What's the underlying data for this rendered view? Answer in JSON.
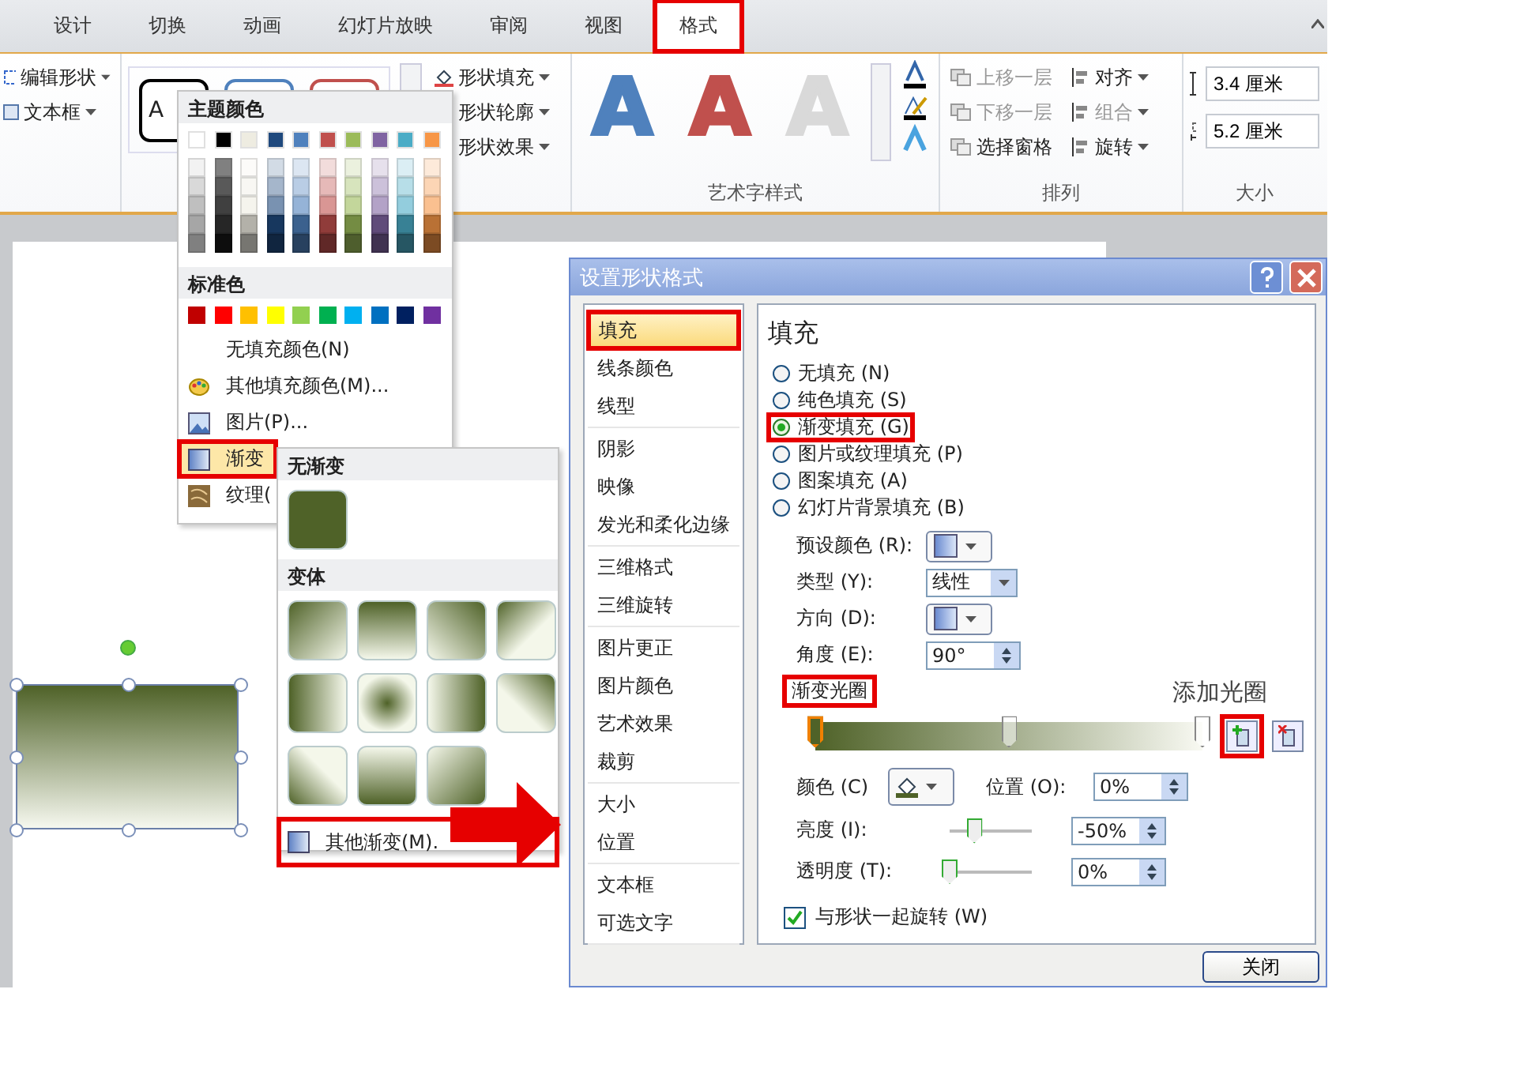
{
  "ribbon": {
    "tabs": [
      {
        "label": "设计",
        "selected": false,
        "highlighted": false
      },
      {
        "label": "切换",
        "selected": false,
        "highlighted": false
      },
      {
        "label": "动画",
        "selected": false,
        "highlighted": false
      },
      {
        "label": "幻灯片放映",
        "selected": false,
        "highlighted": false
      },
      {
        "label": "审阅",
        "selected": false,
        "highlighted": false
      },
      {
        "label": "视图",
        "selected": false,
        "highlighted": false
      },
      {
        "label": "格式",
        "selected": true,
        "highlighted": true
      }
    ],
    "insert_commands": [
      "编辑形状",
      "文本框"
    ],
    "shape_styles": [
      {
        "text": "A",
        "color": "#000000"
      },
      {
        "color": "#4f81bd"
      },
      {
        "color": "#c0504d"
      }
    ],
    "shape_commands": [
      "形状填充",
      "形状轮廓",
      "形状效果"
    ],
    "wordart_styles": [
      {
        "text": "A",
        "color": "#4f81bd"
      },
      {
        "text": "A",
        "color": "#c0504d"
      },
      {
        "text": "A",
        "color": "#d9d9d9"
      }
    ],
    "wordart_group": "艺术字样式",
    "arrange_commands": [
      {
        "label": "上移一层",
        "disabled": true
      },
      {
        "label": "下移一层",
        "disabled": true
      },
      {
        "label": "选择窗格",
        "disabled": false
      },
      {
        "label": "对齐",
        "disabled": false
      },
      {
        "label": "组合",
        "disabled": true
      },
      {
        "label": "旋转",
        "disabled": false
      }
    ],
    "arrange_group": "排列",
    "size_fields": [
      "3.4 厘米",
      "5.2 厘米"
    ],
    "size_group": "大小"
  },
  "fill_menu": {
    "theme_title": "主题颜色",
    "theme_colors": [
      {
        "color": "#ffffff"
      },
      {
        "color": "#000000"
      },
      {
        "color": "#eeece1"
      },
      {
        "color": "#1f497d"
      },
      {
        "color": "#4f81bd"
      },
      {
        "color": "#c0504d"
      },
      {
        "color": "#9bbb59"
      },
      {
        "color": "#8064a2"
      },
      {
        "color": "#4bacc6"
      },
      {
        "color": "#f79646"
      }
    ],
    "standard_title": "标准色",
    "standard_colors": [
      {
        "color": "#c00000"
      },
      {
        "color": "#ff0000"
      },
      {
        "color": "#ffc000"
      },
      {
        "color": "#ffff00"
      },
      {
        "color": "#92d050"
      },
      {
        "color": "#00b050"
      },
      {
        "color": "#00b0f0"
      },
      {
        "color": "#0070c0"
      },
      {
        "color": "#002060"
      },
      {
        "color": "#7030a0"
      }
    ],
    "items": [
      {
        "label": "无填充颜色(N)",
        "kind": "none",
        "selected": false
      },
      {
        "label": "其他填充颜色(M)...",
        "kind": "palette",
        "selected": false
      },
      {
        "label": "图片(P)...",
        "kind": "picture",
        "selected": false
      },
      {
        "label": "渐变",
        "kind": "gradient",
        "selected": true
      },
      {
        "label": "纹理(",
        "kind": "texture",
        "selected": false
      }
    ]
  },
  "gradient_menu": {
    "none_title": "无渐变",
    "variants_title": "变体",
    "more": "其他渐变(M)."
  },
  "dialog": {
    "title": "设置形状格式",
    "category_groups": [
      [
        {
          "label": "填充",
          "selected": true
        },
        {
          "label": "线条颜色",
          "selected": false
        },
        {
          "label": "线型",
          "selected": false
        }
      ],
      [
        {
          "label": "阴影",
          "selected": false
        },
        {
          "label": "映像",
          "selected": false
        },
        {
          "label": "发光和柔化边缘",
          "selected": false
        }
      ],
      [
        {
          "label": "三维格式",
          "selected": false
        },
        {
          "label": "三维旋转",
          "selected": false
        }
      ],
      [
        {
          "label": "图片更正",
          "selected": false
        },
        {
          "label": "图片颜色",
          "selected": false
        },
        {
          "label": "艺术效果",
          "selected": false
        },
        {
          "label": "裁剪",
          "selected": false
        }
      ],
      [
        {
          "label": "大小",
          "selected": false
        },
        {
          "label": "位置",
          "selected": false
        }
      ],
      [
        {
          "label": "文本框",
          "selected": false
        },
        {
          "label": "可选文字",
          "selected": false
        }
      ]
    ],
    "heading": "填充",
    "fill_options": [
      {
        "label": "无填充 (N)",
        "selected": false
      },
      {
        "label": "纯色填充 (S)",
        "selected": false
      },
      {
        "label": "渐变填充 (G)",
        "selected": true
      },
      {
        "label": "图片或纹理填充 (P)",
        "selected": false
      },
      {
        "label": "图案填充 (A)",
        "selected": false
      },
      {
        "label": "幻灯片背景填充 (B)",
        "selected": false
      }
    ],
    "preset_label": "预设颜色 (R):",
    "type_label": "类型 (Y):",
    "type_value": "线性",
    "direction_label": "方向 (D):",
    "angle_label": "角度 (E):",
    "angle_value": "90°",
    "stops_title": "渐变光圈",
    "add_stop_tooltip": "添加光圈",
    "stops": [
      {
        "level": 0,
        "selected": true
      },
      {
        "level": 0.5,
        "selected": false
      },
      {
        "level": 1,
        "selected": false
      }
    ],
    "color_label": "颜色 (C)",
    "position_label": "位置 (O):",
    "position_value": "0%",
    "brightness_label": "亮度 (I):",
    "brightness": {
      "level": 0.3
    },
    "brightness_value": "-50%",
    "transparency_label": "透明度 (T):",
    "transparency": {
      "level": 0
    },
    "transparency_value": "0%",
    "rotate_label": "与形状一起旋转 (W)",
    "rotate_checked": true,
    "close": "关闭"
  }
}
